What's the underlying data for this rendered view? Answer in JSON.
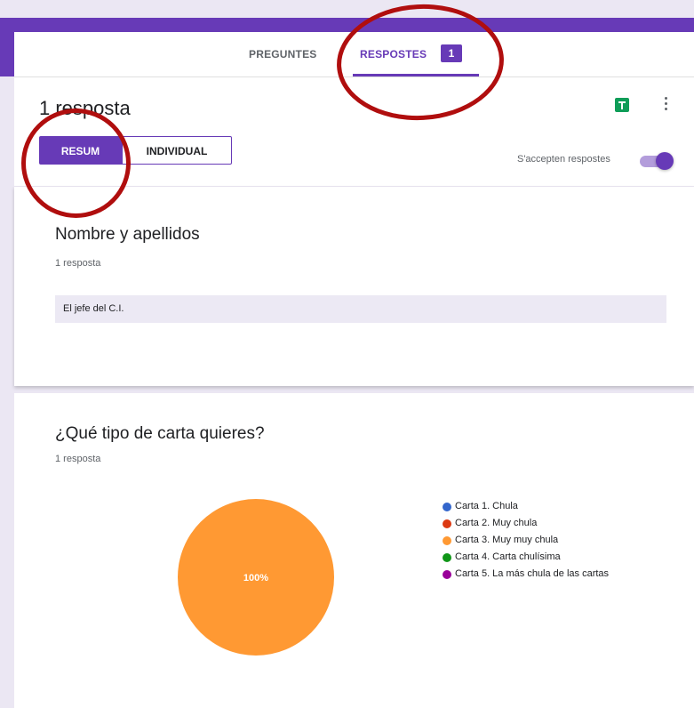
{
  "tabs": {
    "preguntes": "PREGUNTES",
    "respostes": "RESPOSTES",
    "respostes_count": "1"
  },
  "summary": {
    "title": "1 resposta",
    "view_resum": "RESUM",
    "view_individual": "INDIVIDUAL",
    "accepting_label": "S'accepten respostes",
    "accepting_on": true
  },
  "questions": [
    {
      "title": "Nombre y apellidos",
      "count": "1 resposta",
      "answers": [
        "El jefe del C.I."
      ]
    },
    {
      "title": "¿Qué tipo de carta quieres?",
      "count": "1 resposta"
    }
  ],
  "chart_data": {
    "type": "pie",
    "categories": [
      "Carta 1. Chula",
      "Carta 2. Muy chula",
      "Carta 3. Muy muy chula",
      "Carta 4. Carta chulísima",
      "Carta 5. La más chula de las cartas"
    ],
    "values": [
      0,
      0,
      100,
      0,
      0
    ],
    "colors": [
      "#3366cc",
      "#dc3912",
      "#ff9933",
      "#109618",
      "#990099"
    ],
    "slice_labels": [
      "",
      "",
      "100%",
      "",
      ""
    ],
    "legend": "right"
  },
  "icons": {
    "sheets": "sheets-icon",
    "more": "more-vert-icon",
    "toggle": "toggle-switch"
  }
}
